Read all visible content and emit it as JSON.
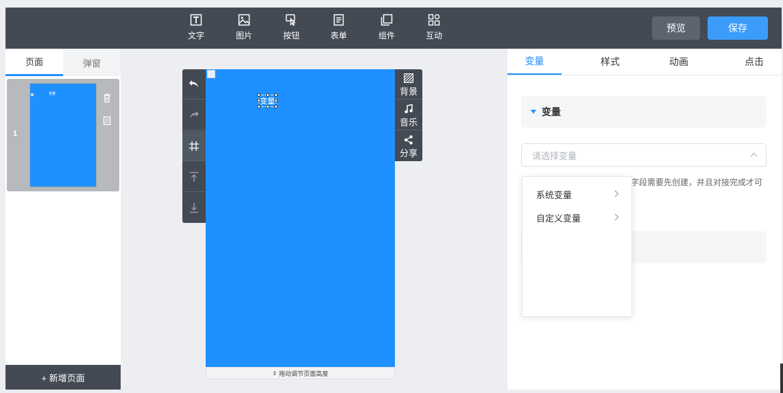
{
  "toolbar": {
    "tools": [
      {
        "label": "文字",
        "icon": "text-icon"
      },
      {
        "label": "图片",
        "icon": "image-icon"
      },
      {
        "label": "按钮",
        "icon": "button-icon"
      },
      {
        "label": "表单",
        "icon": "form-icon"
      },
      {
        "label": "组件",
        "icon": "component-icon"
      },
      {
        "label": "互动",
        "icon": "interaction-icon"
      }
    ],
    "preview_label": "预览",
    "save_label": "保存"
  },
  "left_panel": {
    "tabs": [
      {
        "label": "页面"
      },
      {
        "label": "弹窗"
      }
    ],
    "active_tab": "页面",
    "pages": [
      {
        "number": "1",
        "thumb_text": "变量"
      }
    ],
    "add_page_label": "+ 新增页面"
  },
  "canvas": {
    "element_text": "变量",
    "resize_hint": "拖动调节页面高度",
    "left_tools": [
      "undo-icon",
      "redo-icon",
      "grid-icon",
      "align-top-icon",
      "align-bottom-icon"
    ],
    "right_tools": [
      {
        "label": "背景",
        "icon": "background-icon"
      },
      {
        "label": "音乐",
        "icon": "music-icon"
      },
      {
        "label": "分享",
        "icon": "share-icon"
      }
    ],
    "background_color": "#1e90ff"
  },
  "right_panel": {
    "tabs": [
      {
        "label": "变量"
      },
      {
        "label": "样式"
      },
      {
        "label": "动画"
      },
      {
        "label": "点击"
      }
    ],
    "active_tab": "变量",
    "section_title": "变量",
    "select_placeholder": "请选择变量",
    "hint_text": "字段需要先创建，并且对接完成才可",
    "dropdown_items": [
      {
        "label": "系统变量"
      },
      {
        "label": "自定义变量"
      }
    ]
  },
  "colors": {
    "accent": "#1e90ff",
    "toolbar_bg": "#434a54",
    "save_button": "#3c9cfc"
  }
}
